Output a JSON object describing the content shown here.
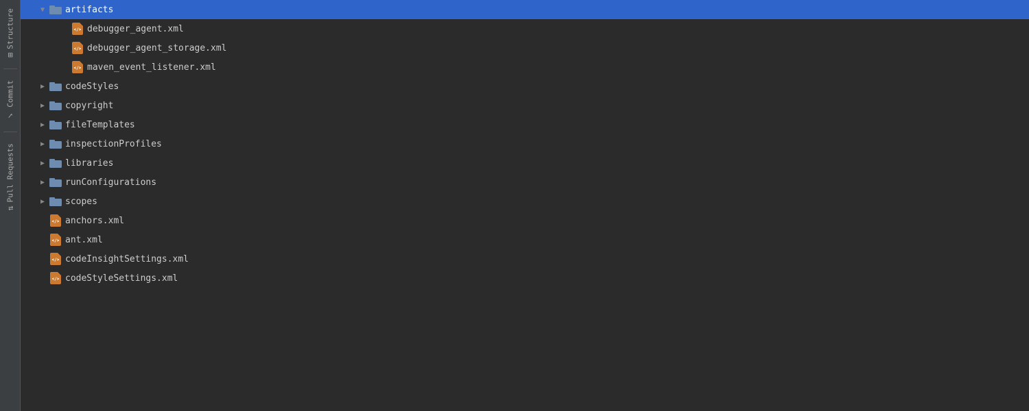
{
  "sidebar": {
    "tabs": [
      {
        "id": "structure",
        "label": "Structure",
        "icon": "⊞"
      },
      {
        "id": "commit",
        "label": "Commit",
        "icon": "✓"
      },
      {
        "id": "pull-requests",
        "label": "Pull Requests",
        "icon": "⇅"
      }
    ]
  },
  "tree": {
    "items": [
      {
        "id": "artifacts",
        "label": "artifacts",
        "type": "folder",
        "indent": 1,
        "state": "expanded",
        "selected": true
      },
      {
        "id": "debugger_agent_xml",
        "label": "debugger_agent.xml",
        "type": "xml",
        "indent": 2,
        "state": "none"
      },
      {
        "id": "debugger_agent_storage_xml",
        "label": "debugger_agent_storage.xml",
        "type": "xml",
        "indent": 2,
        "state": "none"
      },
      {
        "id": "maven_event_listener_xml",
        "label": "maven_event_listener.xml",
        "type": "xml",
        "indent": 2,
        "state": "none"
      },
      {
        "id": "codeStyles",
        "label": "codeStyles",
        "type": "folder",
        "indent": 1,
        "state": "collapsed"
      },
      {
        "id": "copyright",
        "label": "copyright",
        "type": "folder",
        "indent": 1,
        "state": "collapsed"
      },
      {
        "id": "fileTemplates",
        "label": "fileTemplates",
        "type": "folder",
        "indent": 1,
        "state": "collapsed"
      },
      {
        "id": "inspectionProfiles",
        "label": "inspectionProfiles",
        "type": "folder",
        "indent": 1,
        "state": "collapsed"
      },
      {
        "id": "libraries",
        "label": "libraries",
        "type": "folder",
        "indent": 1,
        "state": "collapsed"
      },
      {
        "id": "runConfigurations",
        "label": "runConfigurations",
        "type": "folder",
        "indent": 1,
        "state": "collapsed"
      },
      {
        "id": "scopes",
        "label": "scopes",
        "type": "folder",
        "indent": 1,
        "state": "collapsed"
      },
      {
        "id": "anchors_xml",
        "label": "anchors.xml",
        "type": "xml",
        "indent": 1,
        "state": "none"
      },
      {
        "id": "ant_xml",
        "label": "ant.xml",
        "type": "xml",
        "indent": 1,
        "state": "none"
      },
      {
        "id": "codeInsightSettings_xml",
        "label": "codeInsightSettings.xml",
        "type": "xml",
        "indent": 1,
        "state": "none"
      },
      {
        "id": "codeStyleSettings_xml",
        "label": "codeStyleSettings.xml",
        "type": "xml",
        "indent": 1,
        "state": "none"
      }
    ]
  }
}
